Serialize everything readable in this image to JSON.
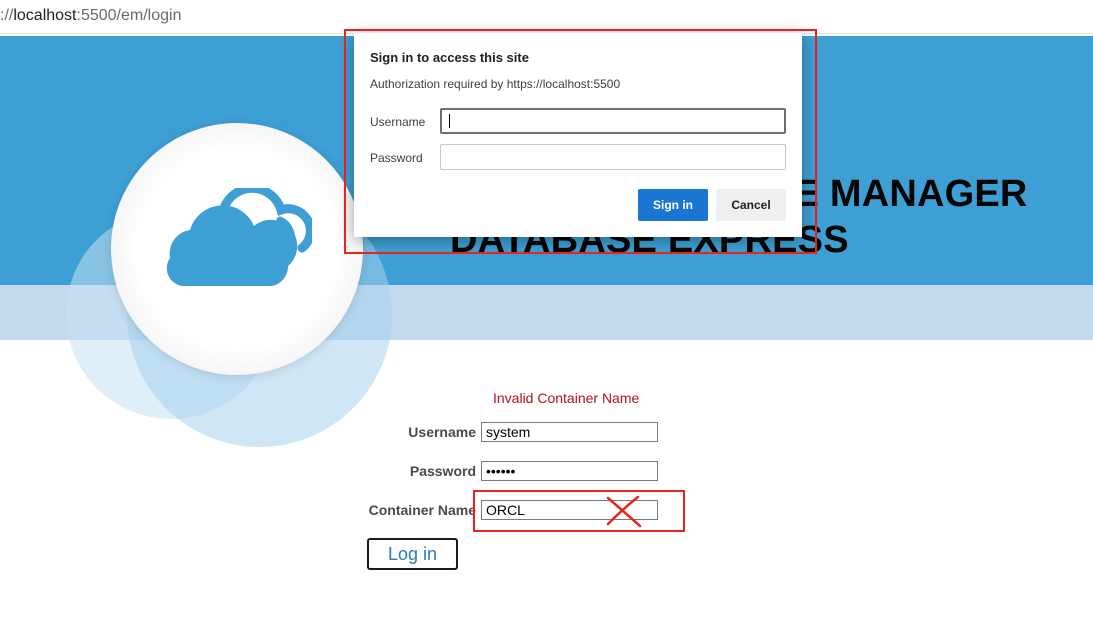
{
  "browser": {
    "url_prefix": "://",
    "url_host": "localhost",
    "url_path": ":5500/em/login"
  },
  "page": {
    "title_line1": "SE MANAGER",
    "title_line2": "DATABASE EXPRESS",
    "error_message": "Invalid Container Name",
    "username_label": "Username",
    "username_value": "system",
    "password_label": "Password",
    "password_value": "••••••",
    "container_label": "Container Name",
    "container_value": "ORCL",
    "login_button": "Log in",
    "logo_icon": "cloud-icon",
    "annotation_color": "#e8231c"
  },
  "dialog": {
    "title": "Sign in to access this site",
    "subtitle": "Authorization required by https://localhost:5500",
    "username_label": "Username",
    "password_label": "Password",
    "signin_button": "Sign in",
    "cancel_button": "Cancel"
  },
  "colors": {
    "banner": "#3d9fd3",
    "stripe": "#c3daee",
    "error": "#b3101e",
    "primary_button": "#1976d2"
  }
}
